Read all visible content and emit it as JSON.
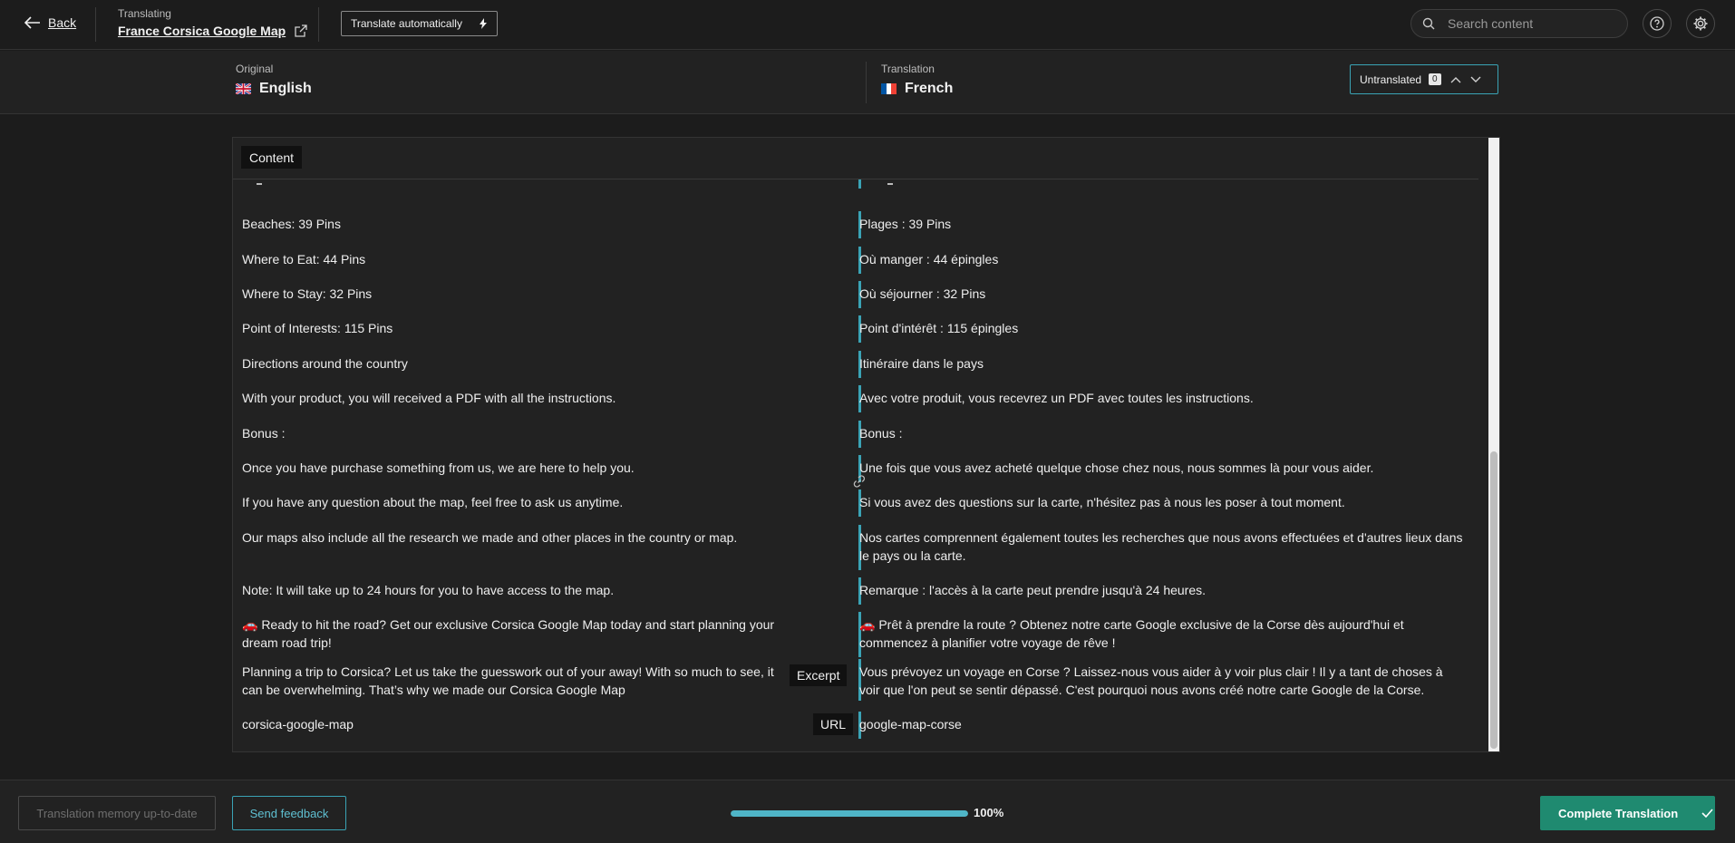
{
  "topbar": {
    "back_label": "Back",
    "context_label": "Translating",
    "document_title": "France Corsica Google Map",
    "translate_auto_label": "Translate automatically",
    "search_placeholder": "Search content"
  },
  "languages": {
    "original_label": "Original",
    "original_name": "English",
    "translation_label": "Translation",
    "translation_name": "French",
    "untranslated_label": "Untranslated",
    "untranslated_count": "0"
  },
  "panel": {
    "tab_label": "Content",
    "rows": [
      {
        "source": "Beaches: 39 Pins",
        "target": "Plages : 39 Pins"
      },
      {
        "source": "Where to Eat: 44 Pins",
        "target": "Où manger : 44 épingles"
      },
      {
        "source": "Where to Stay: 32 Pins",
        "target": "Où séjourner : 32 Pins"
      },
      {
        "source": "Point of Interests: 115 Pins",
        "target": "Point d'intérêt : 115 épingles"
      },
      {
        "source": "Directions around the country",
        "target": "Itinéraire dans le pays"
      },
      {
        "source": "With your product, you will received a PDF with all the instructions.",
        "target": "Avec votre produit, vous recevrez un PDF avec toutes les instructions."
      },
      {
        "source": "Bonus :",
        "target": "Bonus :"
      },
      {
        "source": "Once you have purchase something from us, we are here to help you.",
        "target": "Une fois que vous avez acheté quelque chose chez nous, nous sommes là pour vous aider."
      },
      {
        "source": "If you have any question about the map, feel free to ask us anytime.",
        "target": "Si vous avez des questions sur la carte, n'hésitez pas à nous les poser à tout moment."
      },
      {
        "source": "Our maps also include all the research we made and other places in the country or map.",
        "target": "Nos cartes comprennent également toutes les recherches que nous avons effectuées et d'autres lieux dans le pays ou la carte."
      },
      {
        "source": "Note: It will take up to 24 hours for you to have access to the map.",
        "target": "Remarque : l'accès à la carte peut prendre jusqu'à 24 heures."
      },
      {
        "source": "🚗 Ready to hit the road? Get our exclusive Corsica Google Map today and start planning your dream road trip!",
        "target": "🚗 Prêt à prendre la route ? Obtenez notre carte Google exclusive de la Corse dès aujourd'hui et commencez à planifier votre voyage de rêve !"
      }
    ],
    "excerpt": {
      "tag": "Excerpt",
      "source": "Planning a trip to Corsica? Let us take the guesswork out of your away! With so much to see, it can be overwhelming. That’s why we made our Corsica Google Map",
      "target": "Vous prévoyez un voyage en Corse ? Laissez-nous vous aider à y voir plus clair ! Il y a tant de choses à voir que l'on peut se sentir dépassé. C'est pourquoi nous avons créé notre carte Google de la Corse."
    },
    "url": {
      "tag": "URL",
      "source": "corsica-google-map",
      "target": "google-map-corse"
    }
  },
  "footer": {
    "memory_label": "Translation memory up-to-date",
    "feedback_label": "Send feedback",
    "progress_fraction": 1.0,
    "progress_text": "100%",
    "complete_label": "Complete Translation"
  },
  "colors": {
    "accent": "#3aa3b5",
    "complete": "#1f8a70"
  },
  "icons": {
    "back": "arrow-left-icon",
    "external": "external-link-icon",
    "bolt": "lightning-icon",
    "search": "search-icon",
    "help": "help-icon",
    "settings": "gear-icon",
    "link": "link-icon",
    "check": "check-icon"
  }
}
